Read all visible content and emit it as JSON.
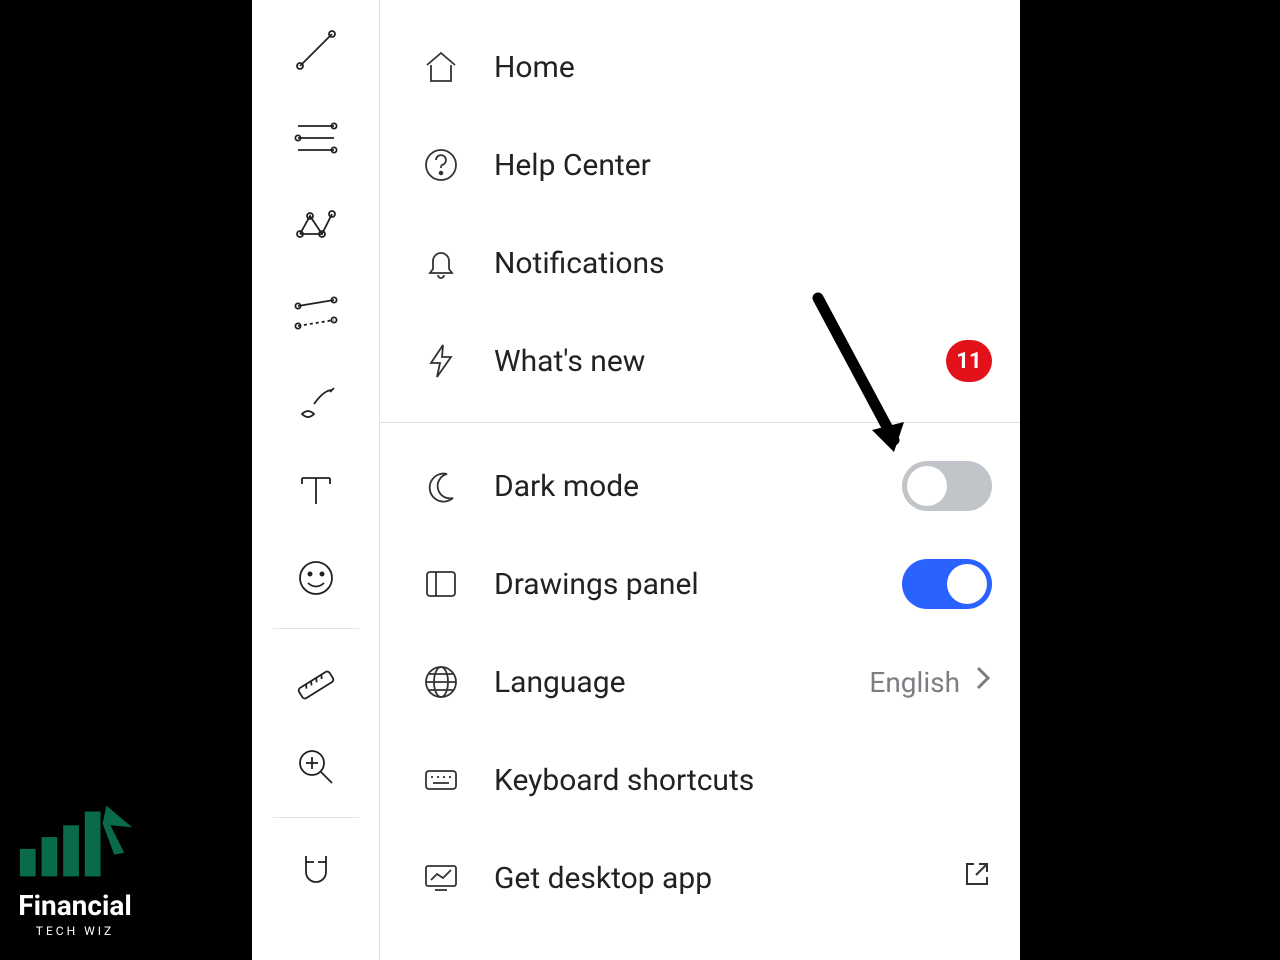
{
  "menu": {
    "home": "Home",
    "help_center": "Help Center",
    "notifications": "Notifications",
    "whats_new": "What's new",
    "whats_new_badge": "11",
    "dark_mode": "Dark mode",
    "dark_mode_on": false,
    "drawings_panel": "Drawings panel",
    "drawings_panel_on": true,
    "language": "Language",
    "language_value": "English",
    "keyboard_shortcuts": "Keyboard shortcuts",
    "get_desktop_app": "Get desktop app"
  },
  "brand": {
    "name": "Financial",
    "sub": "TECH WIZ"
  }
}
